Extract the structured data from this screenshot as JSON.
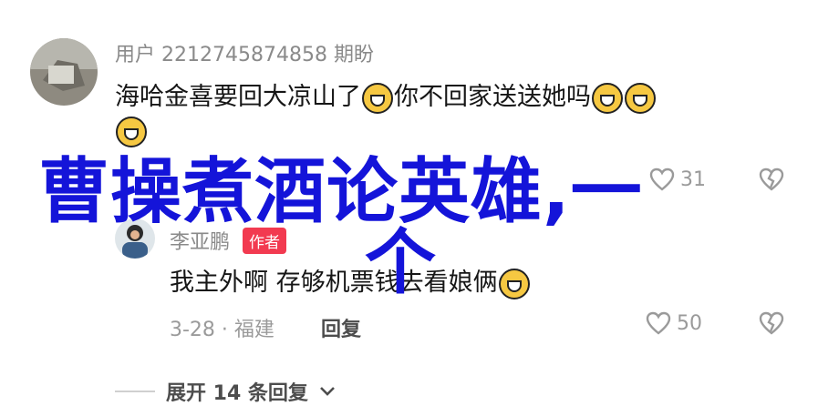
{
  "comment_main": {
    "username": "用户 2212745874858 期盼",
    "text_part1": "海哈金喜要回大凉山了",
    "text_part2": "你不回家送送她吗",
    "likes": "31"
  },
  "reply": {
    "username": "李亚鹏",
    "author_badge": "作者",
    "text": "我主外啊 存够机票钱去看娘俩",
    "date_location": "3-28 · 福建",
    "reply_label": "回复",
    "likes": "50"
  },
  "expand_replies": {
    "label": "展开 14 条回复"
  },
  "overlay": {
    "title": "曹操煮酒论英雄,一",
    "second_line": "个"
  },
  "icons": {
    "emoji": "grinning-squint-emoji",
    "like": "heart-icon",
    "dislike": "broken-heart-icon",
    "chevron": "chevron-down-icon"
  }
}
